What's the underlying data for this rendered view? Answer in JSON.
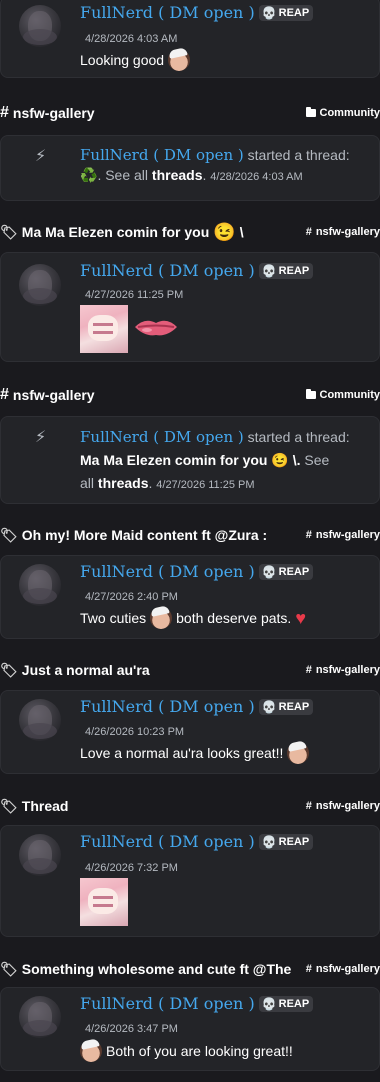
{
  "author_name": "FullNerd ( DM open )",
  "badge_label": "REAP",
  "started_thread_text": "started a thread:",
  "see_all_text": "See all",
  "threads_text": "threads",
  "msg1": {
    "timestamp": "4/28/2026 4:03 AM",
    "text": "Looking good"
  },
  "section2": {
    "title": "nsfw-gallery",
    "tag": "Community"
  },
  "sys1": {
    "thread_name": "♻️.",
    "timestamp": "4/28/2026 4:03 AM"
  },
  "section3": {
    "title": "Ma Ma Elezen comin for you",
    "suffix": "\\",
    "tag": "nsfw-gallery"
  },
  "msg2": {
    "timestamp": "4/27/2026 11:25 PM"
  },
  "section4": {
    "title": "nsfw-gallery",
    "tag": "Community"
  },
  "sys2": {
    "thread_name": "Ma Ma Elezen comin for you",
    "suffix": "\\.",
    "see_line_tail": "See",
    "all_text": "all",
    "timestamp": "4/27/2026 11:25 PM"
  },
  "section5": {
    "title": "Oh my! More Maid content ft @Zura :",
    "tag": "nsfw-gallery"
  },
  "msg3": {
    "timestamp": "4/27/2026 2:40 PM",
    "text_a": "Two cuties",
    "text_b": "both deserve pats."
  },
  "section6": {
    "title": "Just a normal au'ra",
    "tag": "nsfw-gallery"
  },
  "msg4": {
    "timestamp": "4/26/2026 10:23 PM",
    "text": "Love a normal au'ra looks great!!"
  },
  "section7": {
    "title": "Thread",
    "tag": "nsfw-gallery"
  },
  "msg5": {
    "timestamp": "4/26/2026 7:32 PM"
  },
  "section8": {
    "title": "Something wholesome and cute ft @The",
    "tag": "nsfw-gallery"
  },
  "msg6": {
    "timestamp": "4/26/2026 3:47 PM",
    "text": "Both of you are looking great!!"
  },
  "icons": {
    "skull": "skull-icon",
    "hash": "hash-icon",
    "thread": "thread-icon",
    "folder": "folder-icon",
    "recycle": "recycle-icon",
    "wink": "wink-emoji",
    "heart": "heart-emoji",
    "lips": "lips-emoji",
    "face": "custom-face-emoji"
  },
  "colors": {
    "background": "#1a1a1e",
    "card": "#232428",
    "author": "#45a8ee",
    "muted": "#b5bac1",
    "heart": "#e83a4a"
  }
}
